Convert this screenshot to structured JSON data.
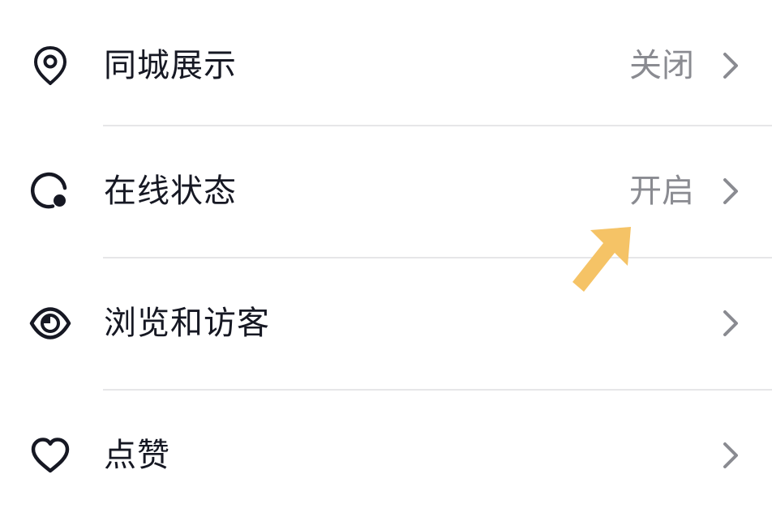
{
  "settings": {
    "items": [
      {
        "label": "同城展示",
        "value": "关闭",
        "icon": "location-pin-icon"
      },
      {
        "label": "在线状态",
        "value": "开启",
        "icon": "online-status-icon"
      },
      {
        "label": "浏览和访客",
        "value": "",
        "icon": "eye-icon"
      },
      {
        "label": "点赞",
        "value": "",
        "icon": "heart-icon"
      }
    ]
  },
  "colors": {
    "label": "#161823",
    "value": "#8a8b91",
    "chevron": "#8a8b91",
    "divider": "#e6e6e8",
    "annotation_arrow": "#f5c366"
  }
}
